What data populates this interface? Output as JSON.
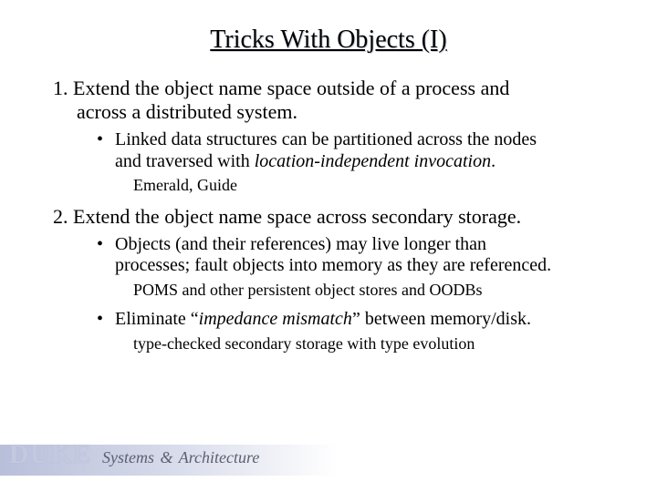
{
  "title": "Tricks With Objects (I)",
  "item1": {
    "num": "1.",
    "line1": "Extend the object name space outside of a process and",
    "line2": "across a distributed system.",
    "bullet1": {
      "line1": "Linked data structures can be partitioned across the nodes",
      "line2_pre": "and traversed with ",
      "line2_italic": "location-independent invocation",
      "line2_post": "."
    },
    "note1": "Emerald, Guide"
  },
  "item2": {
    "num": "2.",
    "line1": "Extend the object name space across secondary storage.",
    "bullet1": {
      "line1": "Objects (and their references) may live longer than",
      "line2": "processes; fault objects into memory as they are referenced."
    },
    "note1": "POMS and other persistent object stores and OODBs",
    "bullet2": {
      "pre": "Eliminate “",
      "italic": "impedance mismatch",
      "post": "” between memory/disk."
    },
    "note2": "type-checked secondary storage with type evolution"
  },
  "footer": {
    "duke": "DUKE",
    "systems": "Systems",
    "amp": "&",
    "arch": "Architecture"
  }
}
